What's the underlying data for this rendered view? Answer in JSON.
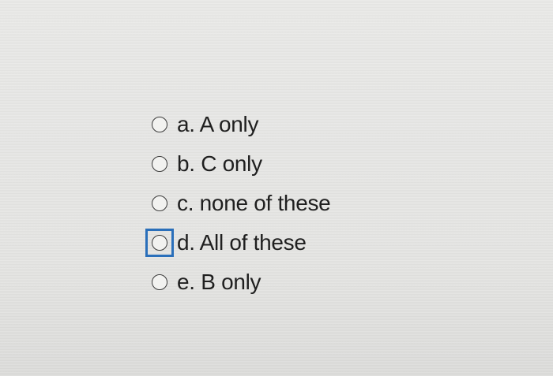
{
  "question": {
    "options": [
      {
        "label": "a. A only",
        "focused": false
      },
      {
        "label": "b. C only",
        "focused": false
      },
      {
        "label": "c. none of these",
        "focused": false
      },
      {
        "label": "d. All of these",
        "focused": true
      },
      {
        "label": "e. B only",
        "focused": false
      }
    ],
    "focus_color": "#2a6fba"
  }
}
